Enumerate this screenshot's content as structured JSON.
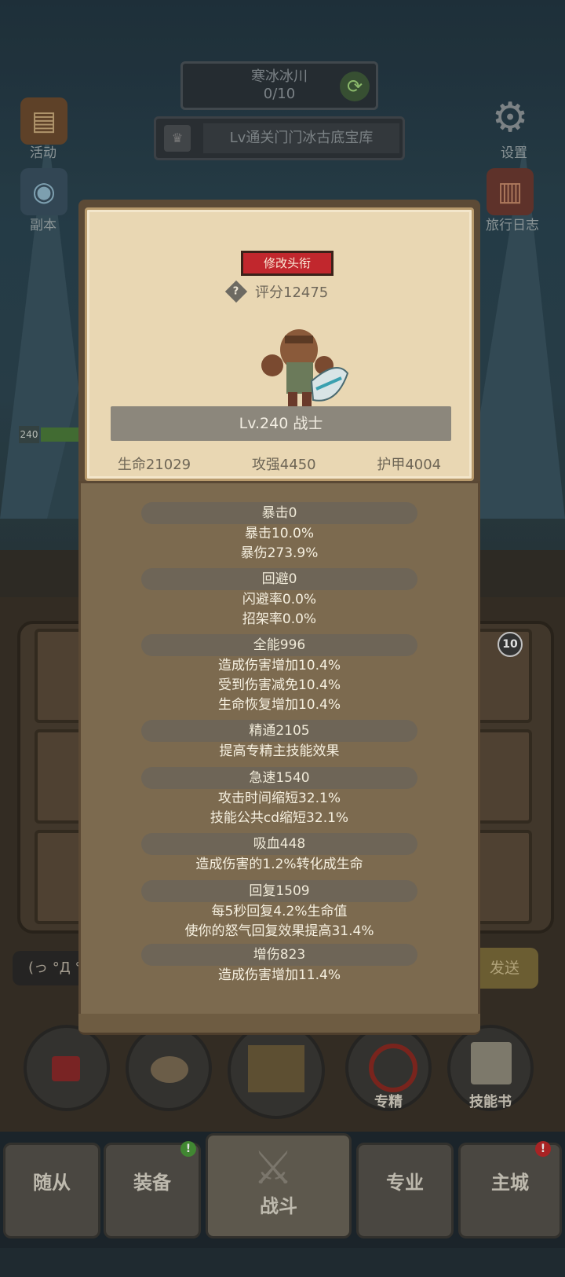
{
  "background": {
    "stage_banner": {
      "title": "寒冰冰川",
      "progress": "0/10"
    },
    "quest_text": "Lv通关门门冰古底宝库",
    "left_icons": [
      {
        "label": "活动",
        "icon": "calendar-book-icon"
      },
      {
        "label": "副本",
        "icon": "portal-icon"
      }
    ],
    "right_icons": [
      {
        "label": "设置",
        "icon": "gear-icon"
      },
      {
        "label": "旅行日志",
        "icon": "journal-icon"
      }
    ],
    "hero_level_badge": "240",
    "card_badge": "10",
    "chat_placeholder": "(っ °Д °",
    "send_label": "发送",
    "round_buttons": [
      {
        "label": "",
        "icon": "potion-icon"
      },
      {
        "label": "",
        "icon": "bread-icon"
      },
      {
        "label": "",
        "icon": "treasure-chest-icon"
      },
      {
        "label": "专精",
        "icon": "specialization-icon"
      },
      {
        "label": "技能书",
        "icon": "skill-book-icon"
      }
    ],
    "nav_tabs": [
      {
        "label": "随从",
        "active": false
      },
      {
        "label": "装备",
        "active": false,
        "badge": "green"
      },
      {
        "label": "战斗",
        "active": true
      },
      {
        "label": "专业",
        "active": false
      },
      {
        "label": "主城",
        "active": false,
        "badge": "red"
      }
    ]
  },
  "profile": {
    "rename_label": "修改头衔",
    "help_icon": "?",
    "score": "评分12475",
    "level_class": "Lv.240 战士",
    "hp": "生命21029",
    "attack": "攻强4450",
    "armor": "护甲4004"
  },
  "stats": [
    {
      "header": "暴击0",
      "lines": [
        "暴击10.0%",
        "暴伤273.9%"
      ]
    },
    {
      "header": "回避0",
      "lines": [
        "闪避率0.0%",
        "招架率0.0%"
      ]
    },
    {
      "header": "全能996",
      "lines": [
        "造成伤害增加10.4%",
        "受到伤害减免10.4%",
        "生命恢复增加10.4%"
      ]
    },
    {
      "header": "精通2105",
      "lines": [
        "提高专精主技能效果"
      ]
    },
    {
      "header": "急速1540",
      "lines": [
        "攻击时间缩短32.1%",
        "技能公共cd缩短32.1%"
      ]
    },
    {
      "header": "吸血448",
      "lines": [
        "造成伤害的1.2%转化成生命"
      ]
    },
    {
      "header": "回复1509",
      "lines": [
        "每5秒回复4.2%生命值",
        "使你的怒气回复效果提高31.4%"
      ]
    },
    {
      "header": "增伤823",
      "lines": [
        "造成伤害增加11.4%"
      ]
    }
  ],
  "colors": {
    "rename_button": "#c1272d",
    "parchment": "#e9d7b3",
    "panel_body": "#7c6a4f"
  }
}
